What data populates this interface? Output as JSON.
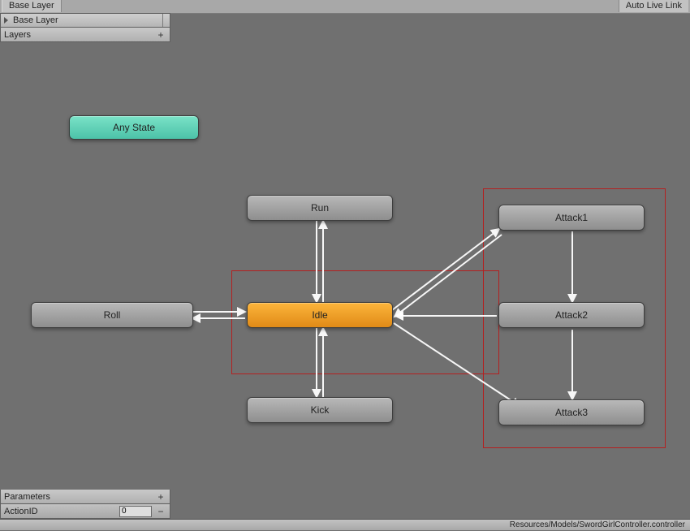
{
  "tab": {
    "label": "Base Layer"
  },
  "topRight": {
    "label": "Auto Live Link"
  },
  "breadcrumb": {
    "label": "Base Layer"
  },
  "layersHeader": "Layers",
  "paramsHeader": "Parameters",
  "nodes": {
    "any": {
      "label": "Any State"
    },
    "run": {
      "label": "Run"
    },
    "roll": {
      "label": "Roll"
    },
    "idle": {
      "label": "Idle"
    },
    "kick": {
      "label": "Kick"
    },
    "attack1": {
      "label": "Attack1"
    },
    "attack2": {
      "label": "Attack2"
    },
    "attack3": {
      "label": "Attack3"
    }
  },
  "parameters": [
    {
      "name": "ActionID",
      "value": "0"
    }
  ],
  "statusPath": "Resources/Models/SwordGirlController.controller"
}
